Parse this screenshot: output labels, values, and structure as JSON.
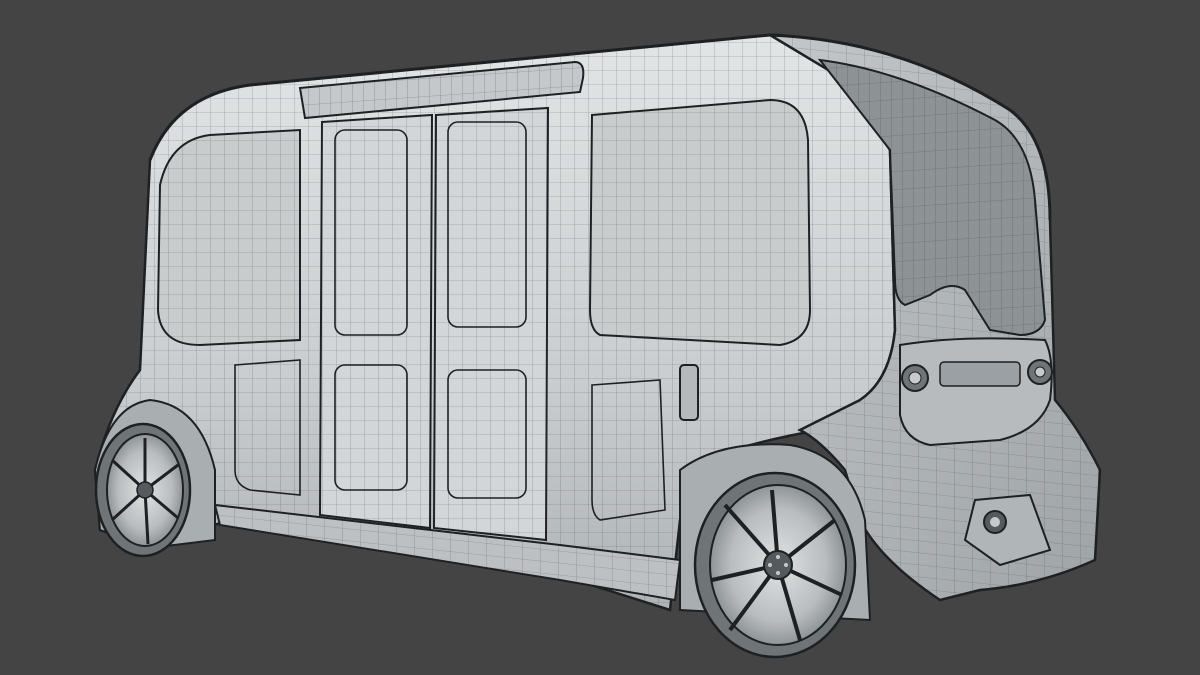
{
  "scene": {
    "subject": "autonomous-shuttle-wireframe",
    "colors": {
      "background": "#444444",
      "body_light": "#d9dcdd",
      "body_mid": "#bfc3c5",
      "body_shade": "#a9aeb1",
      "glass": "#c8cccd",
      "glass_rear": "#8d9295",
      "wire": "#3c4042",
      "edge": "#1e2123",
      "rim": "#c7cacb",
      "tire": "#6f7477"
    }
  }
}
